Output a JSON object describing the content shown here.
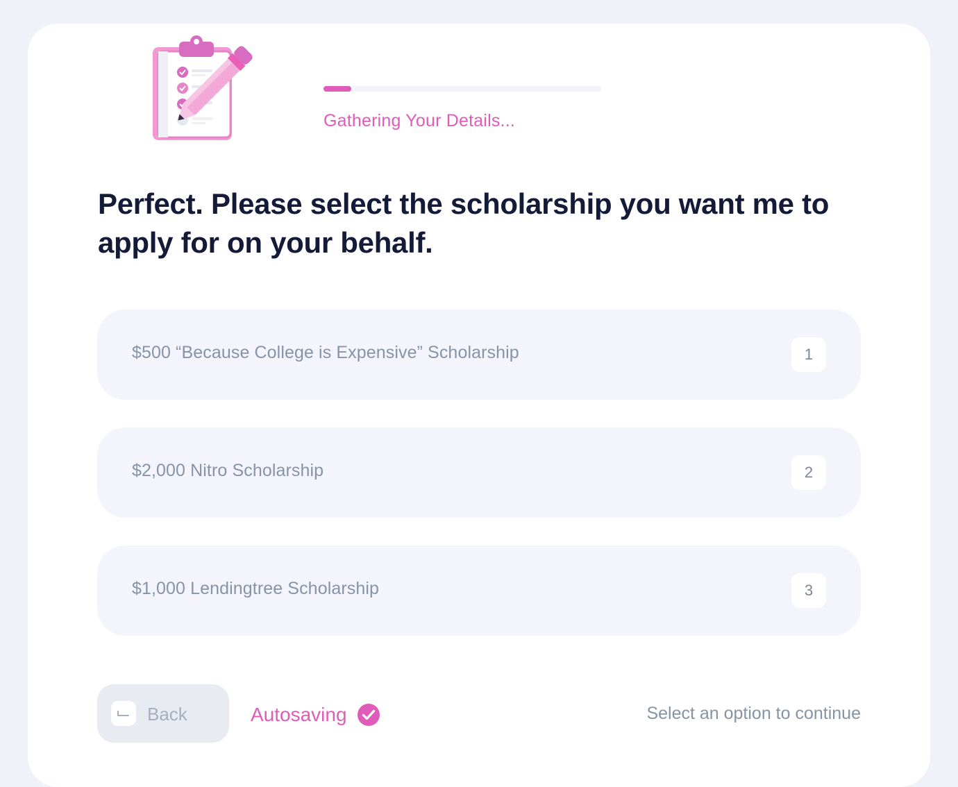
{
  "progress": {
    "fraction": 0.1,
    "label": "Gathering Your Details..."
  },
  "question": {
    "text": "Perfect. Please select the scholarship you want me to apply for on your behalf."
  },
  "options": [
    {
      "label": "$500 “Because College is Expensive” Scholarship",
      "key": "1"
    },
    {
      "label": "$2,000 Nitro Scholarship",
      "key": "2"
    },
    {
      "label": "$1,000 Lendingtree Scholarship",
      "key": "3"
    }
  ],
  "footer": {
    "back_label": "Back",
    "autosave_label": "Autosaving",
    "hint": "Select an option to continue"
  },
  "colors": {
    "accent": "#e05cba",
    "heading": "#141b38",
    "option_bg": "#f4f5fc",
    "muted_text": "#8694a6"
  },
  "icons": {
    "illustration": "clipboard-pencil-icon",
    "autosave": "check-circle-icon",
    "back": "return-arrow-icon"
  }
}
